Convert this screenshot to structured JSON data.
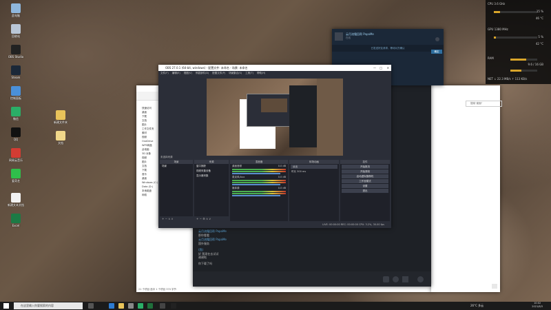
{
  "desktop": {
    "icons": [
      {
        "label": "此电脑",
        "icon": "computer-icon",
        "color": "#8fb7dd"
      },
      {
        "label": "回收站",
        "icon": "recycle-bin-icon",
        "color": "#b9c6d6"
      },
      {
        "label": "OBS Studio",
        "icon": "obs-icon",
        "color": "#222222"
      },
      {
        "label": "Steam",
        "icon": "steam-icon",
        "color": "#1b2838"
      },
      {
        "label": "控制面板",
        "icon": "control-panel-icon",
        "color": "#4a90d9"
      },
      {
        "label": "微信",
        "icon": "wechat-icon",
        "color": "#2aae67"
      },
      {
        "label": "QQ",
        "icon": "qq-icon",
        "color": "#111111"
      },
      {
        "label": "网易云音乐",
        "icon": "music-icon",
        "color": "#d43c33"
      },
      {
        "label": "爱奇艺",
        "icon": "video-icon",
        "color": "#2fbf4b"
      },
      {
        "label": "新建文本文档",
        "icon": "document-icon",
        "color": "#f2f2f2"
      },
      {
        "label": "Excel",
        "icon": "spreadsheet-icon",
        "color": "#1d7a45"
      },
      {
        "label": "新建文件夹",
        "icon": "folder-icon",
        "color": "#e8c35a"
      },
      {
        "label": "文档",
        "icon": "file-icon",
        "color": "#f0d78a"
      }
    ]
  },
  "monitor": {
    "cpu_label": "CPU",
    "cpu_clock": "3.6 GHz",
    "cpu_usage": "15 %",
    "cpu_temp": "46 °C",
    "gpu_label": "GPU",
    "gpu_clock": "1380 MHz",
    "gpu_usage": "5 %",
    "gpu_temp": "42 °C",
    "ram_label": "RAM",
    "ram_usage": "9.6 / 16 GB",
    "net_label": "NET",
    "net_down": "22.3 MB/s",
    "net_up": "113 KB/s",
    "accent": "#d9a52a"
  },
  "steam": {
    "friend_name": "云月流霜回帮 PapaMe",
    "status": "在线",
    "notice": "已发送好友请求，等待对方确认",
    "button": "确定"
  },
  "obs": {
    "title": "OBS 27.0.1 (64-bit, windows) - 配置文件: 未命名 - 场景: 未命名",
    "menu": [
      "文件(F)",
      "编辑(E)",
      "视图(V)",
      "停靠部件(D)",
      "配置文件(P)",
      "场景集合(S)",
      "工具(T)",
      "帮助(H)"
    ],
    "docks": {
      "scenes": {
        "header": "场景",
        "items": [
          "场景"
        ]
      },
      "sources": {
        "header": "来源",
        "items": [
          "窗口捕获",
          "视频采集设备",
          "显示器采集"
        ]
      },
      "mixer": {
        "header": "混音器",
        "channels": [
          "桌面音频",
          "麦克风/Aux",
          "媒体源"
        ],
        "levels": [
          "0.0 dB",
          "0.0 dB",
          "0.0 dB"
        ]
      },
      "transitions": {
        "header": "转场动画",
        "type": "淡出",
        "duration_label": "时长",
        "duration": "300 ms"
      },
      "controls": {
        "header": "控件",
        "buttons": [
          "开始推流",
          "开始录制",
          "启动虚拟摄像机",
          "工作室模式",
          "设置",
          "退出"
        ]
      }
    },
    "status": "LIVE: 00:00:00    REC: 00:00:00    CPU: 3.2%, 30.00 fps"
  },
  "chat": {
    "messages": [
      {
        "name": "云月流霜回帮 PapaMe",
        "text": "那你看看"
      },
      {
        "name": "云月流霜回帮 PapaMe",
        "text": "国外服务"
      },
      {
        "name": "(我)",
        "text": "好 我现在去试试"
      },
      {
        "name": "",
        "text": "谢谢啦"
      },
      {
        "name": "",
        "text": "你下载了吗"
      }
    ]
  },
  "explorer": {
    "nav_items": [
      "快速访问",
      "桌面",
      "下载",
      "文档",
      "图片",
      "工作文件夹",
      "素材",
      "视频",
      "OneDrive",
      "WPS网盘",
      "此电脑",
      "3D 对象",
      "视频",
      "图片",
      "文档",
      "下载",
      "音乐",
      "桌面",
      "Windows (C:)",
      "Data (D:)",
      "本地磁盘",
      "网络"
    ],
    "status": "21 个项目  选中 1 个项目 370 字节",
    "search_placeholder": "搜索\"桌面\""
  },
  "taskbar": {
    "search_placeholder": "在这里输入你要搜索的内容",
    "weather": "26°C 多云",
    "time": "10:02",
    "date": "2021/8/3"
  }
}
